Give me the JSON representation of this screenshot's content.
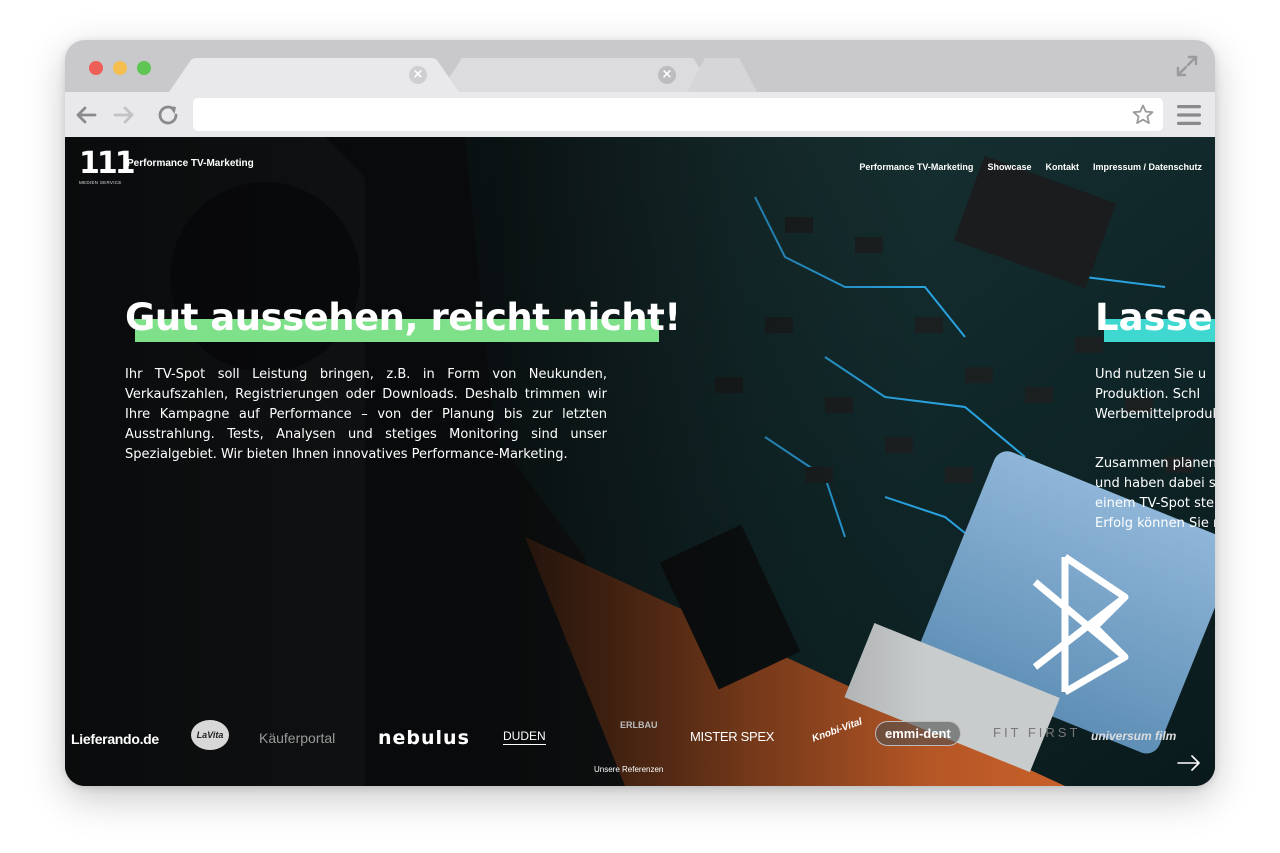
{
  "browser": {
    "tabs": [
      {
        "state": "active",
        "close": "×"
      },
      {
        "state": "inactive",
        "close": "×"
      }
    ],
    "icons": {
      "back": "back-arrow-icon",
      "forward": "forward-arrow-icon",
      "reload": "reload-icon",
      "bookmark": "star-icon",
      "menu": "hamburger-menu-icon",
      "expand": "expand-icon"
    },
    "url_value": ""
  },
  "site": {
    "logo_text": "111",
    "logo_subtext": "MEDIEN SERVICE",
    "brand_title": "Performance TV-Marketing",
    "nav": [
      "Performance TV-Marketing",
      "Showcase",
      "Kontakt",
      "Impressum / Datenschutz"
    ]
  },
  "slide1": {
    "headline": "Gut aussehen, reicht nicht!",
    "accent": "#7fe08a",
    "body": "Ihr TV-Spot soll Leistung bringen, z.B. in Form von Neukunden, Verkaufszahlen, Registrierungen oder Downloads. Deshalb trimmen wir Ihre Kampagne auf Performance – von der Planung bis zur letzten Ausstrahlung. Tests, Analysen und stetiges Monitoring sind unser Spezialgebiet. Wir bieten Ihnen innovatives Performance-Marketing."
  },
  "slide2": {
    "headline": "Lasser",
    "accent": "#3fd8d0",
    "lines_a": [
      "Und nutzen Sie u",
      "Produktion. Schl",
      "Werbemittelproduk"
    ],
    "lines_b": [
      "Zusammen planen",
      "und haben dabei st",
      "einem TV-Spot ste",
      "Erfolg können Sie n"
    ]
  },
  "references": {
    "logos": [
      "Lieferando.de",
      "LaVita",
      "Käuferportal",
      "nebulus",
      "DUDEN",
      "ERLBAU",
      "MISTER SPEX",
      "Knobi-Vital",
      "emmi-dent",
      "FIT FIRST",
      "universum film"
    ],
    "caption": "Unsere Referenzen",
    "next_icon": "arrow-right-icon"
  }
}
